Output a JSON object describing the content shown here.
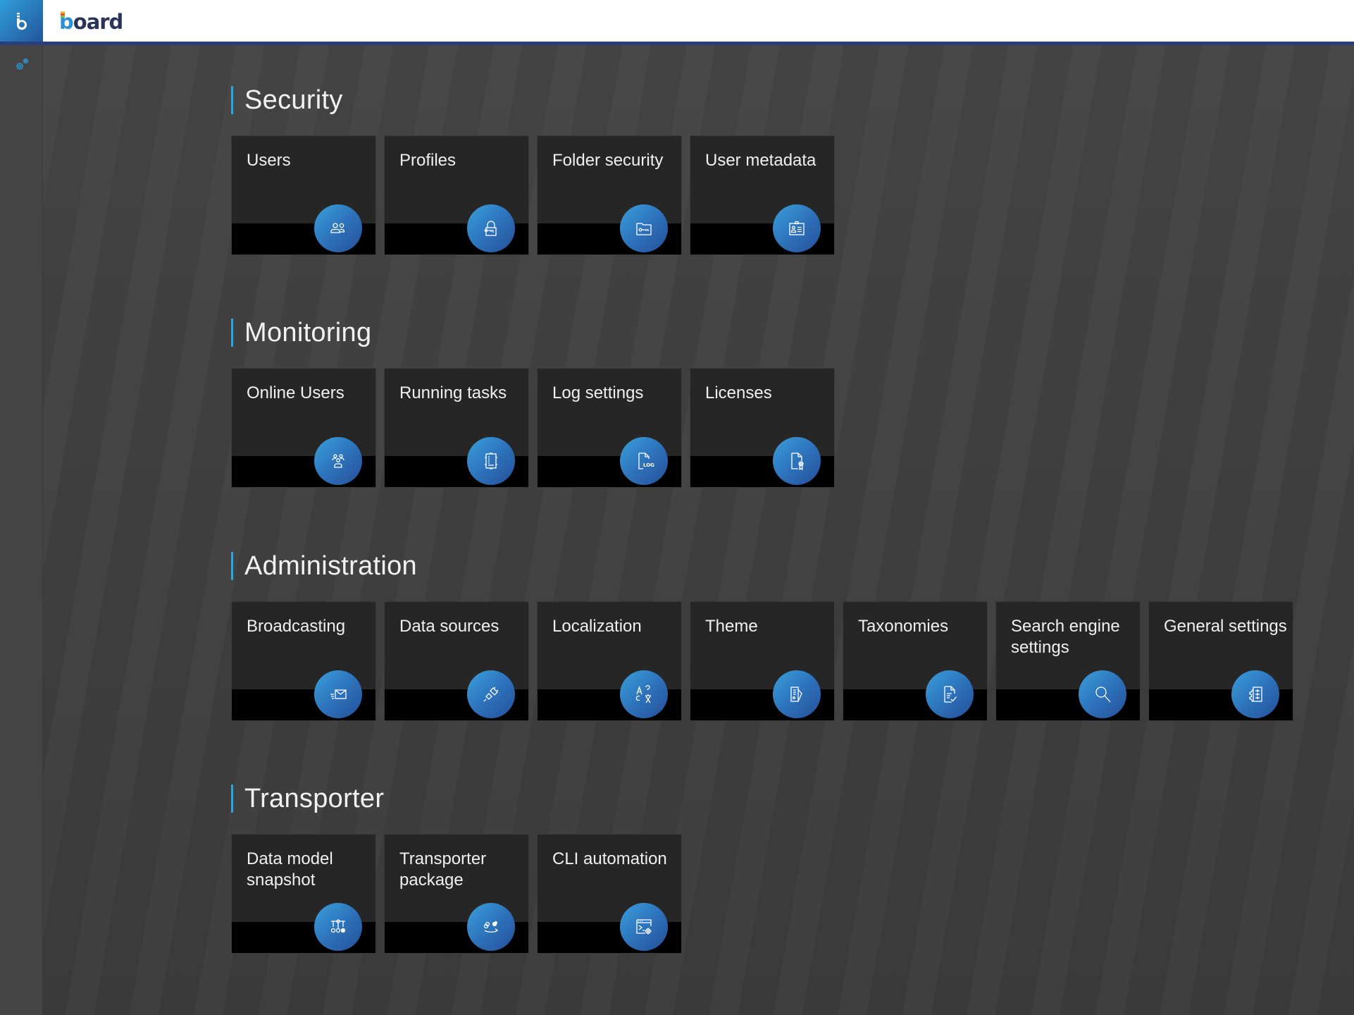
{
  "header": {
    "app_tile_glyph": "b",
    "logo_first": "b",
    "logo_rest": "oard"
  },
  "sidebar": {
    "items": [
      {
        "icon": "gears-icon",
        "label": "System settings"
      }
    ]
  },
  "colors": {
    "accent": "#29a8e0",
    "icon_gradient_start": "#3aa0dc",
    "icon_gradient_end": "#264f99",
    "header_line": "#2a3f7a"
  },
  "sections": [
    {
      "title": "Security",
      "tiles": [
        {
          "label": "Users",
          "icon": "users-icon"
        },
        {
          "label": "Profiles",
          "icon": "lock-key-icon"
        },
        {
          "label": "Folder security",
          "icon": "folder-key-icon"
        },
        {
          "label": "User metadata",
          "icon": "id-card-icon"
        }
      ]
    },
    {
      "title": "Monitoring",
      "tiles": [
        {
          "label": "Online Users",
          "icon": "online-users-icon"
        },
        {
          "label": "Running tasks",
          "icon": "chip-icon"
        },
        {
          "label": "Log settings",
          "icon": "log-file-icon"
        },
        {
          "label": "Licenses",
          "icon": "license-certificate-icon"
        }
      ]
    },
    {
      "title": "Administration",
      "tiles": [
        {
          "label": "Broadcasting",
          "icon": "mail-send-icon"
        },
        {
          "label": "Data sources",
          "icon": "plug-icon"
        },
        {
          "label": "Localization",
          "icon": "translate-icon"
        },
        {
          "label": "Theme",
          "icon": "theme-edit-icon"
        },
        {
          "label": "Taxonomies",
          "icon": "document-check-icon"
        },
        {
          "label": "Search engine settings",
          "icon": "search-icon"
        },
        {
          "label": "General settings",
          "icon": "settings-sliders-icon"
        }
      ]
    },
    {
      "title": "Transporter",
      "tiles": [
        {
          "label": "Data model snapshot",
          "icon": "data-model-icon"
        },
        {
          "label": "Transporter package",
          "icon": "transfer-icon"
        },
        {
          "label": "CLI automation",
          "icon": "terminal-gear-icon"
        }
      ]
    }
  ]
}
